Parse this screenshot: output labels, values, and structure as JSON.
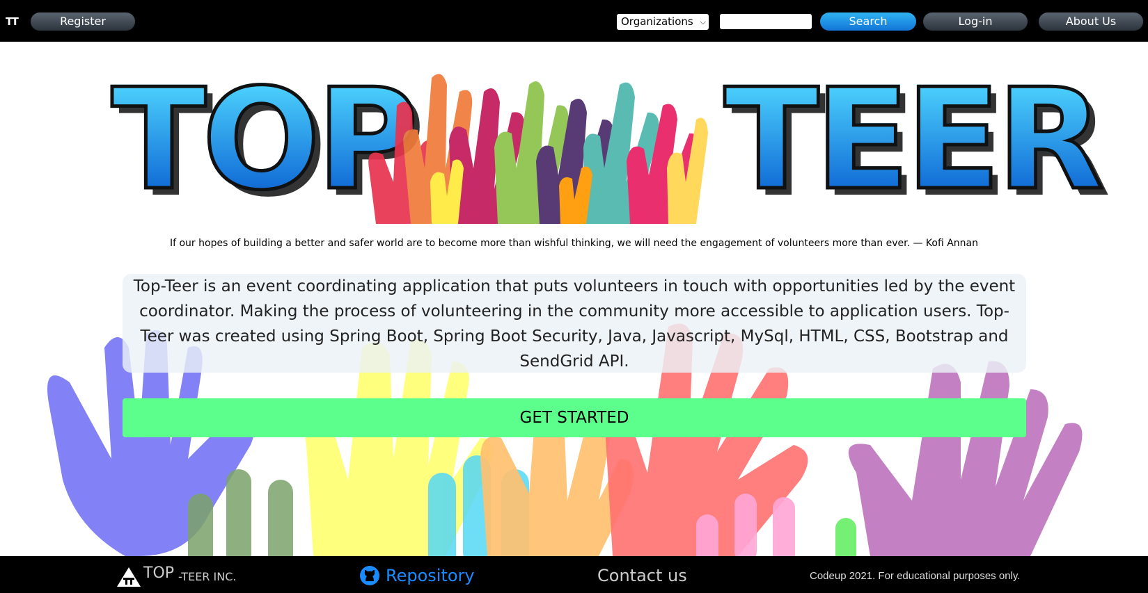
{
  "navbar": {
    "brand": "TT",
    "register_label": "Register",
    "organizations_select": {
      "selected": "Organizations"
    },
    "search_input": {
      "value": "",
      "placeholder": ""
    },
    "search_label": "Search",
    "login_label": "Log-in",
    "about_label": "About Us"
  },
  "hero": {
    "logo_word_left": "TOP",
    "logo_word_right": "TEER",
    "quote": "If our hopes of building a better and safer world are to become more than wishful thinking, we will need the engagement of volunteers more than ever. — Kofi Annan",
    "description": "Top-Teer is an event coordinating application that puts volunteers in touch with opportunities led by the event coordinator. Making the process of volunteering in the community more accessible to application users. Top-Teer was created using Spring Boot, Spring Boot Security, Java, Javascript, MySql, HTML, CSS, Bootstrap and SendGrid API.",
    "cta_label": "GET STARTED"
  },
  "footer": {
    "brand_big": "TOP",
    "brand_small": "-TEER INC.",
    "repository_label": "Repository",
    "contact_label": "Contact us",
    "copyright": "Codeup 2021. For educational purposes only."
  },
  "icons": {
    "brand": "tt-logo-icon",
    "select_chevron": "chevron-down-icon",
    "footer_brand": "tt-logo-icon",
    "repository": "github-icon"
  },
  "colors": {
    "navbar_bg": "#000000",
    "search_button": "#1c8fe6",
    "nav_pill": "#3a434c",
    "cta_bg": "#5cff8c",
    "repo_link": "#1a8cff",
    "desc_box_bg": "#ebf2f6"
  }
}
